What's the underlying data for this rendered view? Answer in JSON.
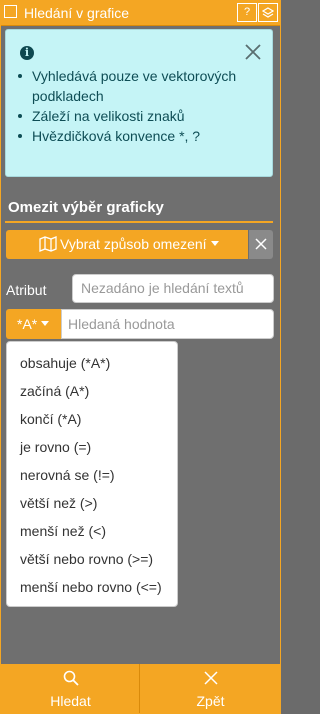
{
  "window": {
    "title": "Hledání v grafice",
    "help_label": "?",
    "icon": "search-window-icon",
    "layers_icon": "layers-icon"
  },
  "info": {
    "icon": "info-icon",
    "icon_text": "i",
    "bullets": [
      "Vyhledává pouze ve vektorových podkladech",
      "Záleží na velikosti znaků",
      "Hvězdičková konvence *, ?"
    ]
  },
  "selection": {
    "title": "Omezit výběr graficky",
    "mode_label": "Vybrat způsob omezení",
    "mode_icon": "map-icon"
  },
  "attribute": {
    "label": "Atribut",
    "placeholder": "Nezadáno je hledání textů"
  },
  "search": {
    "operator": "*A*",
    "placeholder": "Hledaná hodnota",
    "operators": [
      "obsahuje (*A*)",
      "začíná (A*)",
      "končí (*A)",
      "je rovno (=)",
      "nerovná se (!=)",
      "větší než (>)",
      "menší než (<)",
      "větší nebo rovno (>=)",
      "menší nebo rovno (<=)"
    ]
  },
  "footer": {
    "search_label": "Hledat",
    "back_label": "Zpět"
  },
  "colors": {
    "accent": "#f4a623",
    "panel": "#6f6f6f",
    "info_bg": "#c5f4f6"
  }
}
